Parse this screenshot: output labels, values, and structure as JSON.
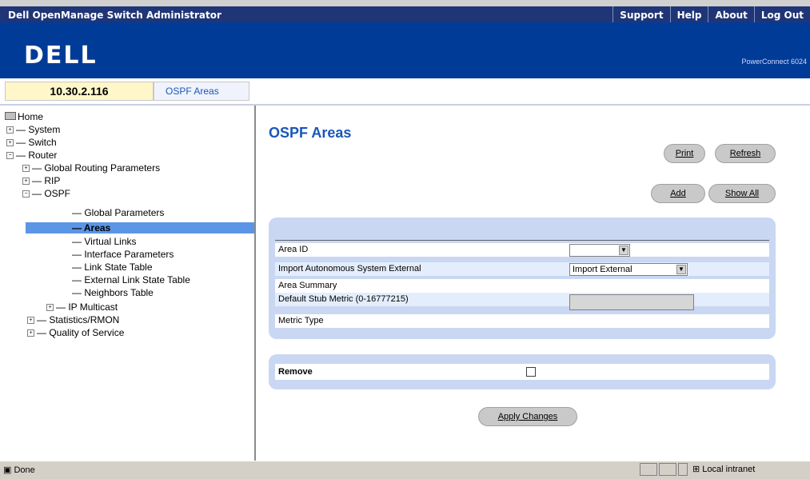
{
  "app_title": "Dell OpenManage Switch Administrator",
  "top_links": [
    "Support",
    "Help",
    "About",
    "Log Out"
  ],
  "logo_text": "D¢LL",
  "model": "PowerConnect 6024",
  "ip_address": "10.30.2.116",
  "breadcrumb": "OSPF Areas",
  "tree": {
    "home": "Home",
    "system": "System",
    "switch": "Switch",
    "router": "Router",
    "global_routing": "Global Routing Parameters",
    "rip": "RIP",
    "ospf": "OSPF",
    "global_params": "Global Parameters",
    "areas": "Areas",
    "virtual_links": "Virtual Links",
    "interface_params": "Interface Parameters",
    "link_state": "Link State Table",
    "ext_link_state": "External Link State Table",
    "neighbors": "Neighbors Table",
    "ip_multicast": "IP Multicast",
    "stats": "Statistics/RMON",
    "qos": "Quality of Service"
  },
  "page": {
    "title": "OSPF Areas",
    "print": "Print",
    "refresh": "Refresh",
    "add": "Add",
    "show_all": "Show All",
    "area_id_label": "Area ID",
    "area_id_value": "",
    "import_label": "Import Autonomous System External",
    "import_value": "Import External",
    "area_summary_label": "Area Summary",
    "stub_metric_label": "Default Stub Metric (0-16777215)",
    "metric_type_label": "Metric Type",
    "remove_label": "Remove",
    "apply": "Apply Changes"
  },
  "status": {
    "done": "Done",
    "zone": "Local intranet"
  }
}
